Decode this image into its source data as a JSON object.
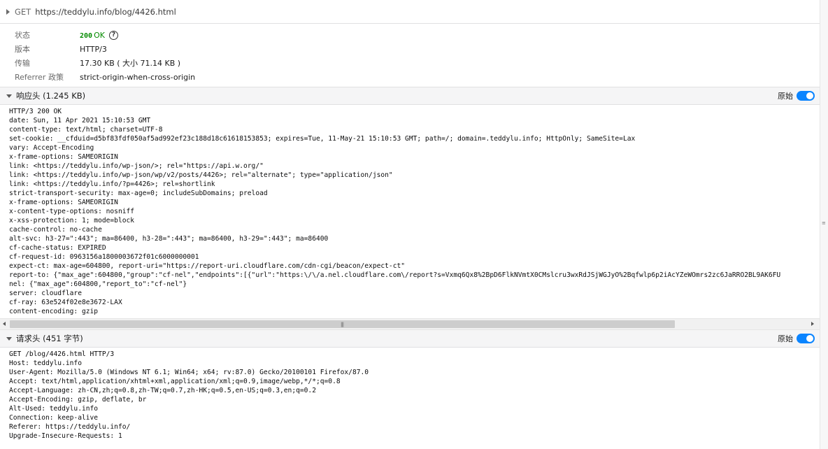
{
  "request": {
    "method": "GET",
    "url": "https://teddylu.info/blog/4426.html"
  },
  "summary": {
    "status_label": "状态",
    "status_code": "200",
    "status_text": "OK",
    "version_label": "版本",
    "version_value": "HTTP/3",
    "transfer_label": "传输",
    "transfer_value": "17.30 KB ( 大小 71.14 KB )",
    "referrer_label": "Referrer 政策",
    "referrer_value": "strict-origin-when-cross-origin"
  },
  "response_headers": {
    "title": "响应头 (1.245 KB)",
    "raw_label": "原始",
    "raw_enabled": true,
    "raw_text": "HTTP/3 200 OK\ndate: Sun, 11 Apr 2021 15:10:53 GMT\ncontent-type: text/html; charset=UTF-8\nset-cookie: __cfduid=d5bf83fdf050af5ad992ef23c188d18c61618153853; expires=Tue, 11-May-21 15:10:53 GMT; path=/; domain=.teddylu.info; HttpOnly; SameSite=Lax\nvary: Accept-Encoding\nx-frame-options: SAMEORIGIN\nlink: <https://teddylu.info/wp-json/>; rel=\"https://api.w.org/\"\nlink: <https://teddylu.info/wp-json/wp/v2/posts/4426>; rel=\"alternate\"; type=\"application/json\"\nlink: <https://teddylu.info/?p=4426>; rel=shortlink\nstrict-transport-security: max-age=0; includeSubDomains; preload\nx-frame-options: SAMEORIGIN\nx-content-type-options: nosniff\nx-xss-protection: 1; mode=block\ncache-control: no-cache\nalt-svc: h3-27=\":443\"; ma=86400, h3-28=\":443\"; ma=86400, h3-29=\":443\"; ma=86400\ncf-cache-status: EXPIRED\ncf-request-id: 0963156a1800003672f01c6000000001\nexpect-ct: max-age=604800, report-uri=\"https://report-uri.cloudflare.com/cdn-cgi/beacon/expect-ct\"\nreport-to: {\"max_age\":604800,\"group\":\"cf-nel\",\"endpoints\":[{\"url\":\"https:\\/\\/a.nel.cloudflare.com\\/report?s=Vxmq6Qx8%2BpD6FlkNVmtX0CMslcru3wxRdJSjWGJyO%2Bqfwlp6p2iAcYZeWOmrs2zc6JaRRO2BL9AK6FU\nnel: {\"max_age\":604800,\"report_to\":\"cf-nel\"}\nserver: cloudflare\ncf-ray: 63e524f02e8e3672-LAX\ncontent-encoding: gzip"
  },
  "request_headers": {
    "title": "请求头 (451 字节)",
    "raw_label": "原始",
    "raw_enabled": true,
    "raw_text": "GET /blog/4426.html HTTP/3\nHost: teddylu.info\nUser-Agent: Mozilla/5.0 (Windows NT 6.1; Win64; x64; rv:87.0) Gecko/20100101 Firefox/87.0\nAccept: text/html,application/xhtml+xml,application/xml;q=0.9,image/webp,*/*;q=0.8\nAccept-Language: zh-CN,zh;q=0.8,zh-TW;q=0.7,zh-HK;q=0.5,en-US;q=0.3,en;q=0.2\nAccept-Encoding: gzip, deflate, br\nAlt-Used: teddylu.info\nConnection: keep-alive\nReferer: https://teddylu.info/\nUpgrade-Insecure-Requests: 1"
  },
  "icons": {
    "expand": "triangle-right-icon",
    "collapse": "caret-down-icon",
    "help": "question-circle-icon"
  }
}
